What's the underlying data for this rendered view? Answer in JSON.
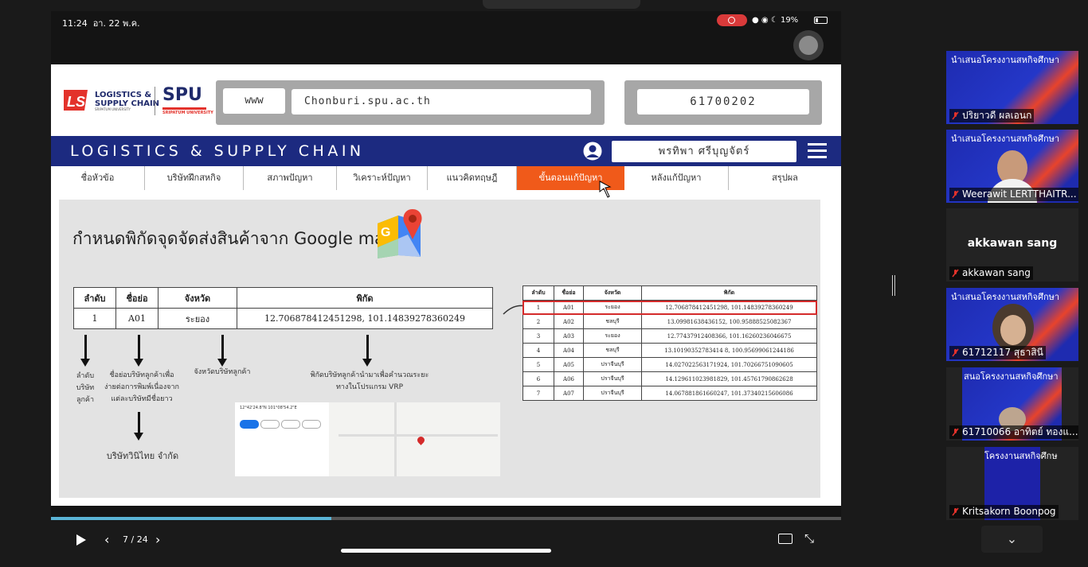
{
  "status_bar": {
    "time": "11:24",
    "date": "อา. 22 พ.ค.",
    "battery": "19%"
  },
  "slide": {
    "logo": {
      "ls_text1": "LOGISTICS &",
      "ls_text2": "SUPPLY CHAIN",
      "ls_sub": "SRIPATUM UNIVERSITY",
      "spu": "SPU",
      "spu_sub": "SRIPATUM UNIVERSITY"
    },
    "www_label": "www",
    "url": "Chonburi.spu.ac.th",
    "student_id": "61700202",
    "nav_title": "LOGISTICS & SUPPLY CHAIN",
    "student_name": "พรทิพา ศรีบุญจัตร์",
    "tabs": [
      "ชื่อหัวข้อ",
      "บริษัทฝึกสหกิจ",
      "สภาพปัญหา",
      "วิเคราะห์ปัญหา",
      "แนวคิดทฤษฎี",
      "ขั้นตอนแก้ปัญหา",
      "หลังแก้ปัญหา",
      "สรุปผล"
    ],
    "content_title": "กำหนดพิกัดจุดจัดส่งสินค้าจาก Google map",
    "left_table": {
      "headers": [
        "ลำดับ",
        "ชื่อย่อ",
        "จังหวัด",
        "พิกัด"
      ],
      "row": [
        "1",
        "A01",
        "ระยอง",
        "12.706878412451298, 101.14839278360249"
      ]
    },
    "labels": {
      "order": "ลำดับ\nบริษัท\nลูกค้า",
      "abbr": "ชื่อย่อบริษัทลูกค้าเพื่อ\nง่ายต่อการพิมพ์เนื่องจาก\nแต่ละบริษัทมีชื่อยาว",
      "province": "จังหวัดบริษัทลูกค้า",
      "coord": "พิกัดบริษัทลูกค้านำมาเพื่อคำนวณระยะ\nทางในโปรแกรม VRP",
      "company": "บริษัทวินิไทย จำกัด"
    },
    "map_coord": "12°42'24.8\"N 101°08'54.2\"E",
    "right_table": {
      "headers": [
        "ลำดับ",
        "ชื่อย่อ",
        "จังหวัด",
        "พิกัด"
      ],
      "rows": [
        [
          "1",
          "A01",
          "ระยอง",
          "12.706878412451298, 101.14839278360249"
        ],
        [
          "2",
          "A02",
          "ชลบุรี",
          "13.09981638436152, 100.95888525082367"
        ],
        [
          "3",
          "A03",
          "ระยอง",
          "12.77437912408366, 101.16260236046675"
        ],
        [
          "4",
          "A04",
          "ชลบุรี",
          "13.10190352783414 8, 100.95699061244186"
        ],
        [
          "5",
          "A05",
          "ปราจีนบุรี",
          "14.027022563171924, 101.70266751090605"
        ],
        [
          "6",
          "A06",
          "ปราจีนบุรี",
          "14.129611023981829, 101.45761790862628"
        ],
        [
          "7",
          "A07",
          "ปราจีนบุรี",
          "14.067881861660247, 101.37340215606086"
        ]
      ]
    }
  },
  "controls": {
    "page": "7 / 24",
    "progress": 0.355
  },
  "participants": [
    {
      "name": "ปริยาวดี ผลเอนก",
      "caption": "นำเสนอโครงงานสหกิจศึกษา"
    },
    {
      "name": "Weerawit LERTTHAITR...",
      "caption": "นำเสนอโครงงานสหกิจศึกษา"
    },
    {
      "name": "akkawan sang",
      "center": "akkawan sang"
    },
    {
      "name": "61712117 สุธาสินี",
      "caption": "นำเสนอโครงงานสหกิจศึกษา"
    },
    {
      "name": "61710066 อาทิตย์ ทองแ...",
      "caption": "สนอโครงงานสหกิจศึกษา"
    },
    {
      "name": "Kritsakorn Boonpog",
      "caption": "โครงงานสหกิจศึกษ"
    }
  ],
  "colors": {
    "navbar": "#1c2a80",
    "active_tab": "#f05a1a",
    "highlight": "#d42a2a",
    "progress": "#5ab4d6"
  }
}
